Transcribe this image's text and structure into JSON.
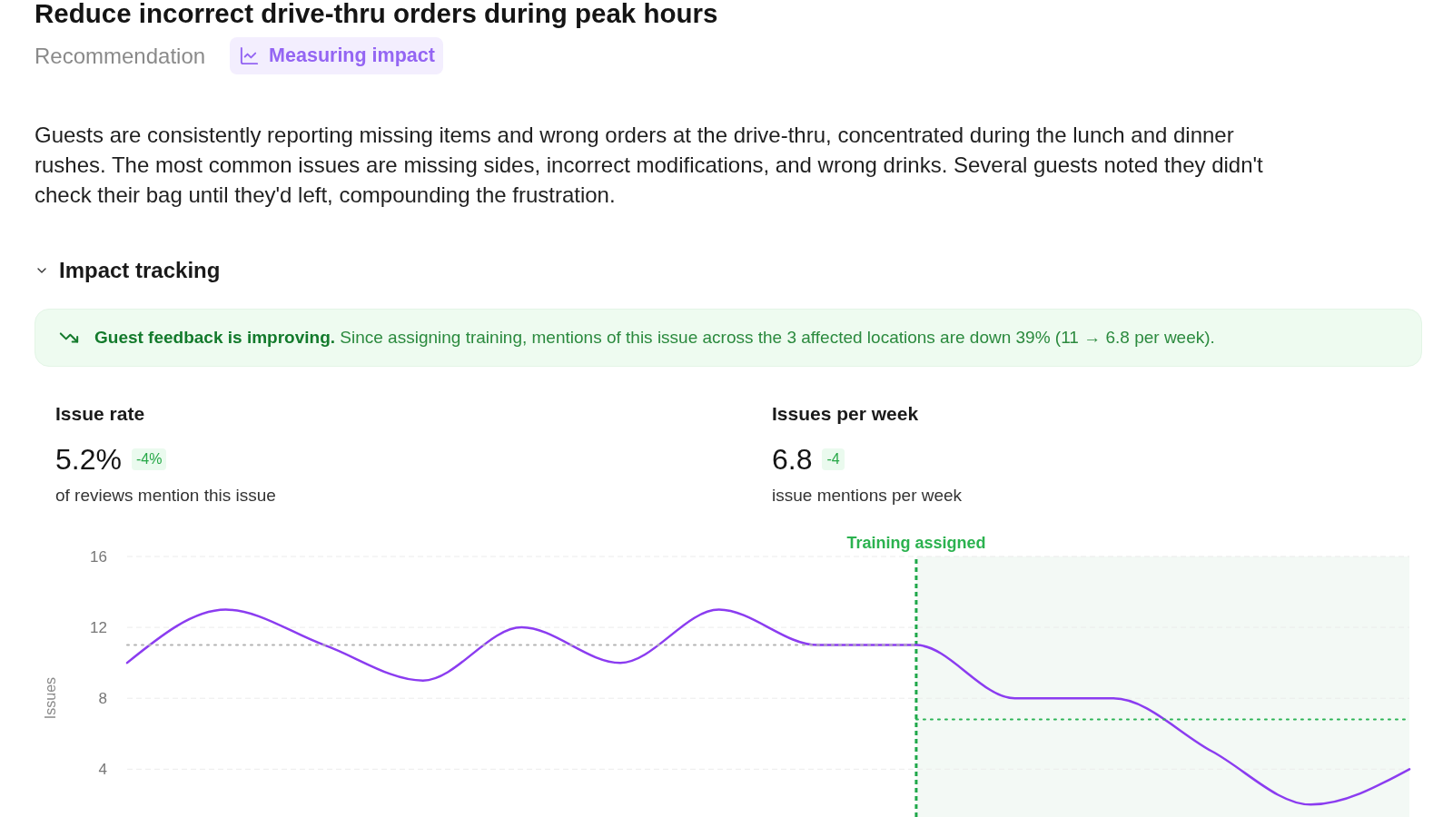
{
  "header": {
    "title": "Reduce incorrect drive-thru orders during peak hours",
    "category": "Recommendation",
    "status": {
      "label": "Measuring impact"
    }
  },
  "description": "Guests are consistently reporting missing items and wrong orders at the drive-thru, concentrated during the lunch and dinner rushes. The most common issues are missing sides, incorrect modifications, and wrong drinks. Several guests noted they didn't check their bag until they'd left, compounding the frustration.",
  "impact_tracking": {
    "title": "Impact tracking",
    "expanded": true,
    "banner": {
      "text": "**Guest feedback is improving.** Since assigning training, mentions of this issue across the 3 affected locations are down 39% (11 → 6.8 per week)."
    },
    "metrics": [
      {
        "label": "Issue rate",
        "value": "5.2%",
        "change": "-4%",
        "caption": "of reviews mention this issue"
      },
      {
        "label": "Issues per week",
        "value": "6.8",
        "change": "-4",
        "caption": "issue mentions per week"
      }
    ],
    "chart_data": {
      "type": "line",
      "ylabel": "Issues",
      "categories": [
        null,
        null,
        null,
        null,
        null,
        null,
        null,
        null,
        null,
        null,
        null,
        null,
        null,
        null
      ],
      "ylim": [
        1.3,
        16
      ],
      "yticks": [
        4,
        8,
        12,
        16
      ],
      "grid": true,
      "series": [
        {
          "color": "#8b3cf0",
          "line_style": "solid",
          "values": [
            10,
            13,
            11,
            9,
            12,
            10,
            13,
            11,
            11,
            8,
            8,
            5,
            2,
            4
          ]
        },
        {
          "color": "#b4b4b4",
          "line_style": "dotted",
          "values": [
            11,
            11,
            11,
            11,
            11,
            11,
            11,
            11,
            11,
            null,
            null,
            null,
            null,
            null
          ]
        },
        {
          "color": "#2db456",
          "line_style": "dotted",
          "values": [
            null,
            null,
            null,
            null,
            null,
            null,
            null,
            null,
            6.8,
            6.8,
            6.8,
            6.8,
            6.8,
            6.8
          ]
        }
      ],
      "annotations": [
        {
          "text": "Training assigned"
        }
      ]
    }
  }
}
